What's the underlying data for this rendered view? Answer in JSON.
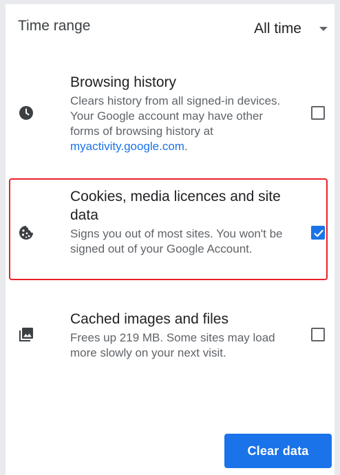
{
  "time_range": {
    "label": "Time range",
    "selected": "All time"
  },
  "options": [
    {
      "title": "Browsing history",
      "desc_1": "Clears history from all signed-in devices. Your Google account may have other forms of browsing history at ",
      "link": "myactivity.google.com",
      "desc_2": ".",
      "icon": "clock-icon",
      "checked": false
    },
    {
      "title": "Cookies, media licences and site data",
      "desc": "Signs you out of most sites. You won't be signed out of your Google Account.",
      "icon": "cookie-icon",
      "checked": true
    },
    {
      "title": "Cached images and files",
      "desc": "Frees up 219 MB. Some sites may load more slowly on your next visit.",
      "icon": "images-icon",
      "checked": false
    }
  ],
  "clear_button": {
    "label": "Clear data"
  },
  "colors": {
    "accent": "#1a73e8",
    "highlight": "#e8202a"
  }
}
